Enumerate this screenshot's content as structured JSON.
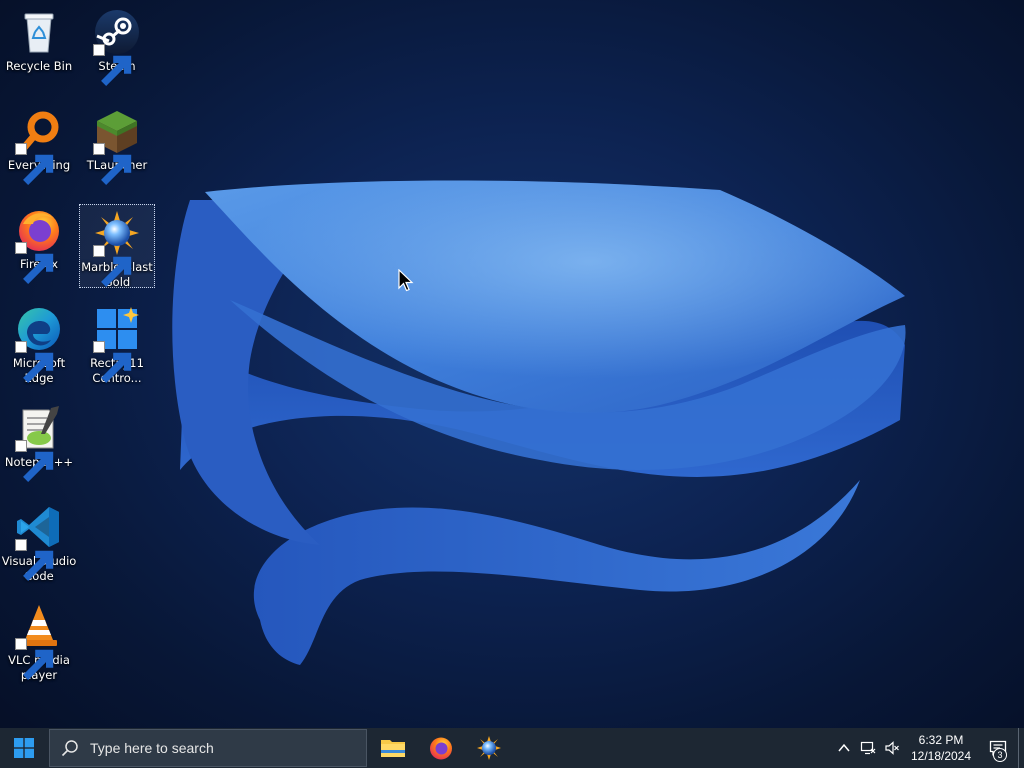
{
  "desktop": {
    "icons": [
      {
        "label": "Recycle Bin",
        "icon": "recycle-bin-icon"
      },
      {
        "label": "Steam",
        "icon": "steam-icon"
      },
      {
        "label": "Everything",
        "icon": "everything-search-icon"
      },
      {
        "label": "TLauncher",
        "icon": "tlauncher-grass-block-icon"
      },
      {
        "label": "Firefox",
        "icon": "firefox-icon"
      },
      {
        "label": "Marble Blast\nGold",
        "icon": "marble-blast-icon"
      },
      {
        "label": "Microsoft\nEdge",
        "icon": "edge-icon"
      },
      {
        "label": "Rectify11\nContro...",
        "icon": "rectify11-icon"
      },
      {
        "label": "Notepad++",
        "icon": "notepadpp-icon"
      },
      {
        "label": "Visual Studio\nCode",
        "icon": "vscode-icon"
      },
      {
        "label": "VLC media\nplayer",
        "icon": "vlc-icon"
      }
    ]
  },
  "taskbar": {
    "search": {
      "placeholder": "Type here to search"
    },
    "pinned": [
      {
        "name": "File Explorer",
        "icon": "file-explorer-icon"
      },
      {
        "name": "Firefox",
        "icon": "firefox-icon"
      },
      {
        "name": "Marble Blast Gold",
        "icon": "marble-blast-icon"
      }
    ],
    "tray": {
      "time": "6:32 PM",
      "date": "12/18/2024",
      "notification_count": "3"
    }
  },
  "colors": {
    "taskbar": "#1d2733",
    "accent": "#0078d4",
    "wallpaper_dark": "#081737",
    "wallpaper_ribbon": "#3b7ddd"
  }
}
